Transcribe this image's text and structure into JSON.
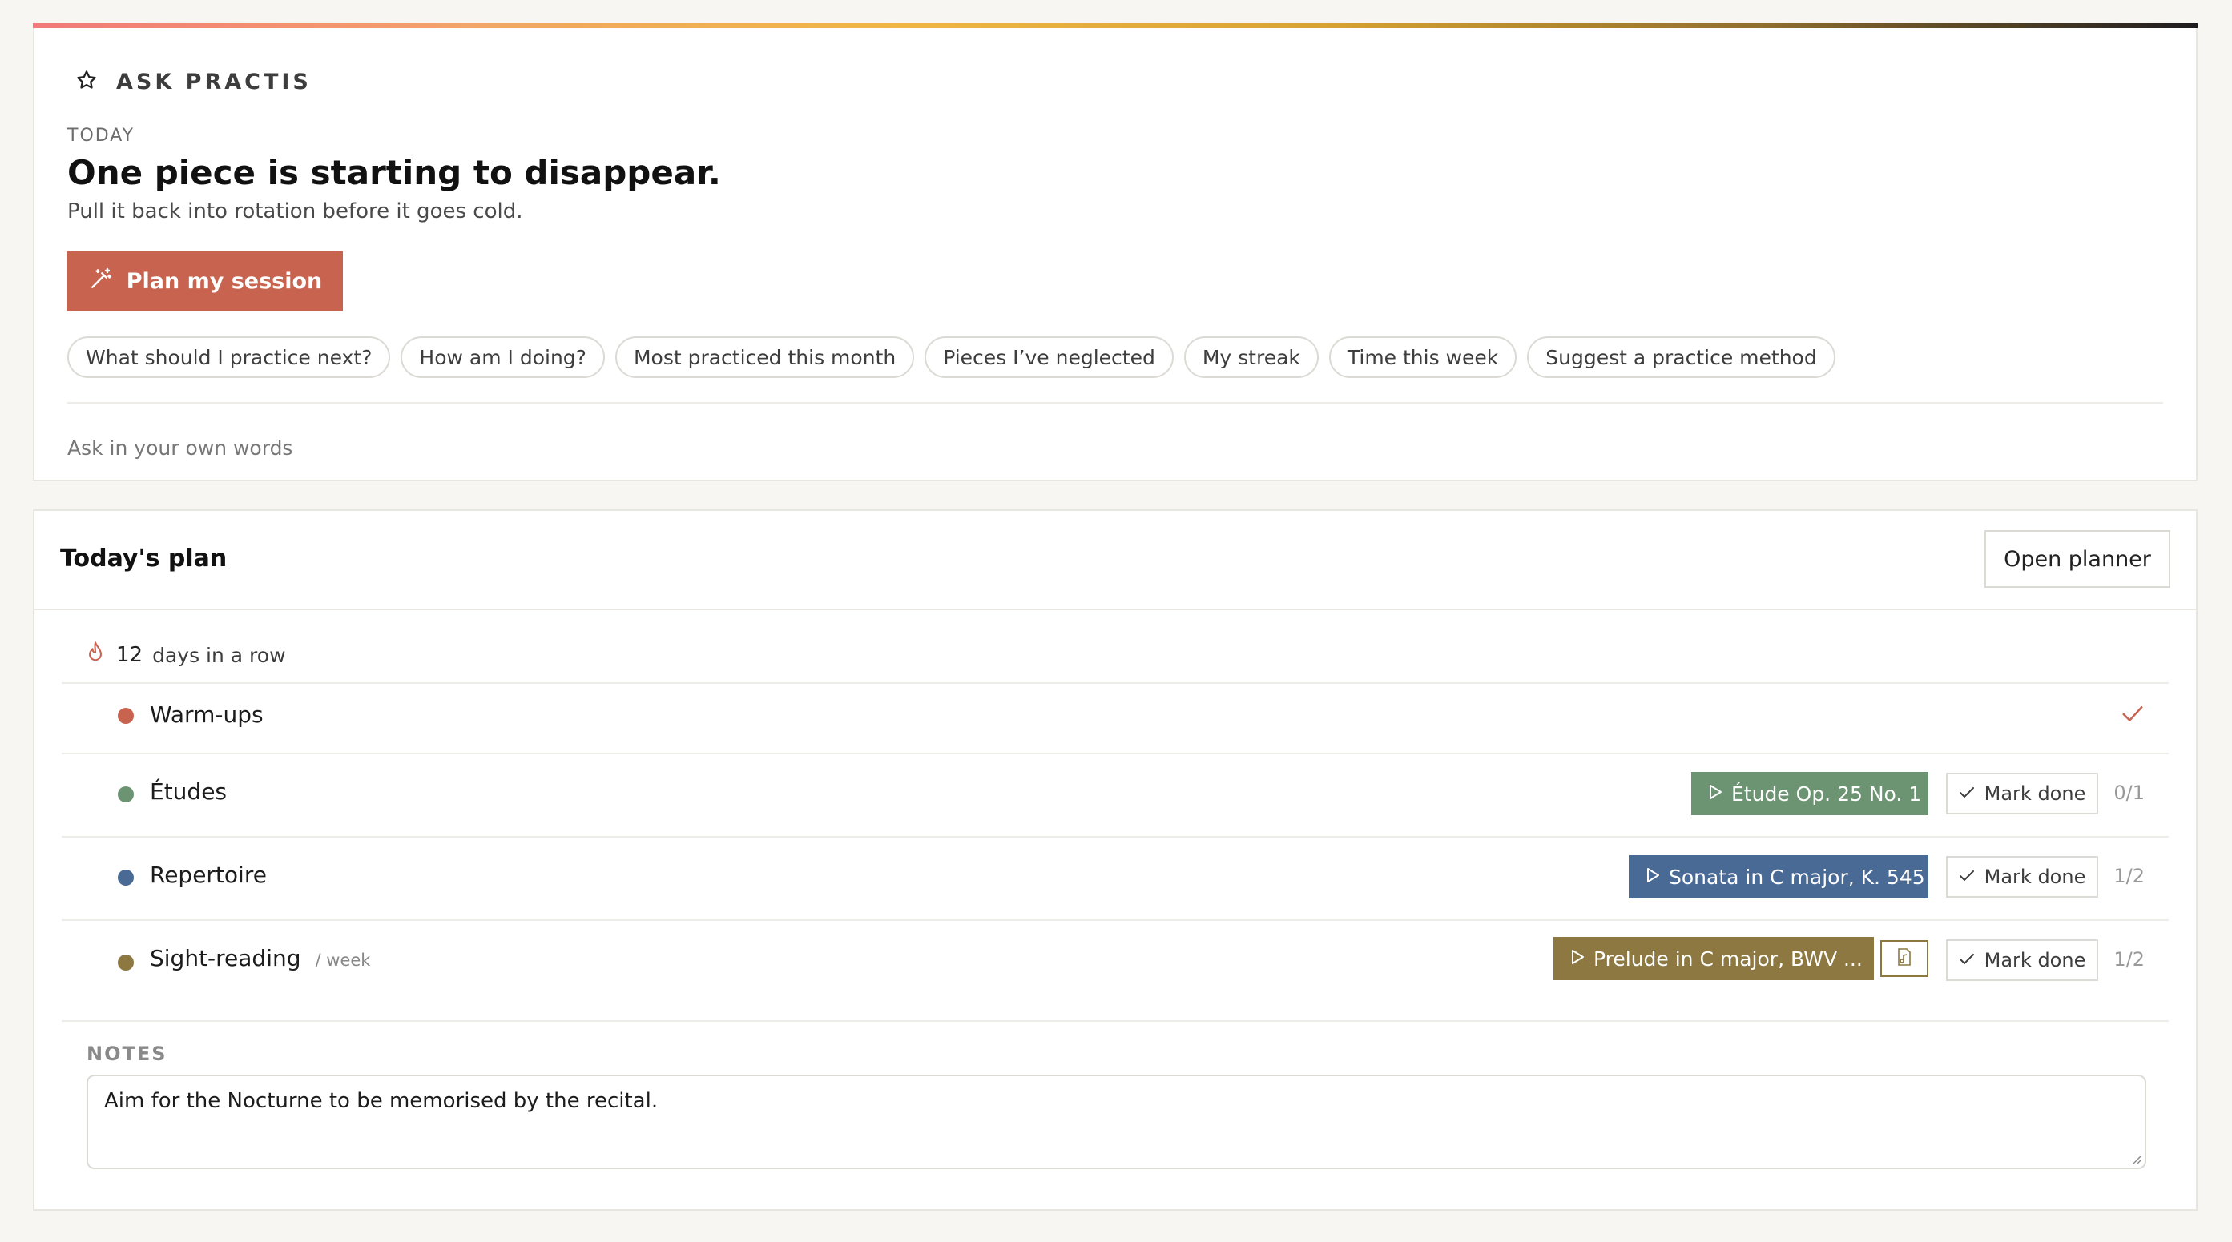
{
  "ask": {
    "title": "ASK PRACTIS",
    "today_label": "TODAY",
    "headline": "One piece is starting to disappear.",
    "subline": "Pull it back into rotation before it goes cold.",
    "plan_button": "Plan my session",
    "chips": [
      "What should I practice next?",
      "How am I doing?",
      "Most practiced this month",
      "Pieces I’ve neglected",
      "My streak",
      "Time this week",
      "Suggest a practice method"
    ],
    "input_placeholder": "Ask in your own words"
  },
  "plan": {
    "title": "Today's plan",
    "open_planner": "Open planner",
    "streak": {
      "count": "12",
      "label": "days in a row",
      "icon": "flame-icon"
    },
    "rows": [
      {
        "label": "Warm-ups",
        "color": "#c8634f",
        "done": true
      },
      {
        "label": "Études",
        "color": "#6d9472",
        "piece": "Étude Op. 25 No. 1",
        "piece_color": "#6d9472",
        "mark": "Mark done",
        "count": "0/1"
      },
      {
        "label": "Repertoire",
        "color": "#4a6a96",
        "piece": "Sonata in C major, K. 545",
        "piece_color": "#4a6a96",
        "mark": "Mark done",
        "count": "1/2"
      },
      {
        "label": "Sight-reading",
        "sub": "/ week",
        "color": "#8c7840",
        "piece": "Prelude in C major, BWV ...",
        "piece_color": "#8c7840",
        "mark": "Mark done",
        "count": "1/2"
      }
    ],
    "notes_label": "NOTES",
    "notes_text": "Aim for the Nocturne to be memorised by the recital."
  },
  "colors": {
    "accent": "#c8634f",
    "border": "#dcdad5"
  }
}
